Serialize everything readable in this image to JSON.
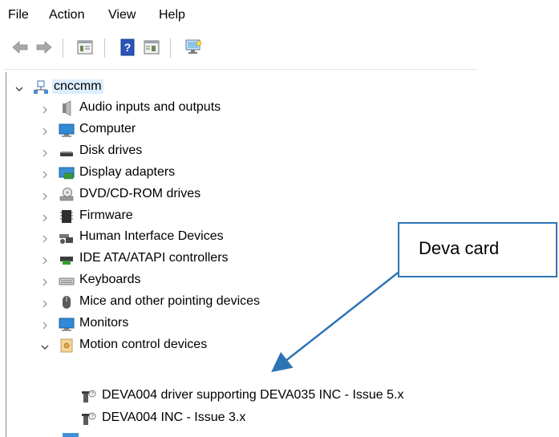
{
  "menu": [
    "File",
    "Action",
    "View",
    "Help"
  ],
  "toolbar": {
    "icons": [
      "back-arrow-icon",
      "forward-arrow-icon",
      "properties-icon",
      "help-icon",
      "update-driver-icon",
      "scan-hardware-icon"
    ]
  },
  "tree": {
    "root": "cnccmm",
    "categories": [
      {
        "label": "Audio inputs and outputs",
        "icon": "speaker-icon"
      },
      {
        "label": "Computer",
        "icon": "monitor-icon"
      },
      {
        "label": "Disk drives",
        "icon": "disk-drive-icon"
      },
      {
        "label": "Display adapters",
        "icon": "display-adapter-icon"
      },
      {
        "label": "DVD/CD-ROM drives",
        "icon": "dvd-drive-icon"
      },
      {
        "label": "Firmware",
        "icon": "firmware-icon"
      },
      {
        "label": "Human Interface Devices",
        "icon": "hid-icon"
      },
      {
        "label": "IDE ATA/ATAPI controllers",
        "icon": "ide-controller-icon"
      },
      {
        "label": "Keyboards",
        "icon": "keyboard-icon"
      },
      {
        "label": "Mice and other pointing devices",
        "icon": "mouse-icon"
      },
      {
        "label": "Monitors",
        "icon": "monitor-icon"
      },
      {
        "label": "Motion control devices",
        "icon": "motion-control-icon"
      }
    ],
    "motion_devices": [
      "DEVA004 driver supporting DEVA035 INC - Issue 5.x",
      "DEVA004 INC - Issue 3.x"
    ]
  },
  "callout": {
    "text": "Deva card"
  },
  "colors": {
    "callout_border": "#2d74b5",
    "arrow": "#2d74b5",
    "selection": "#dceeff"
  }
}
